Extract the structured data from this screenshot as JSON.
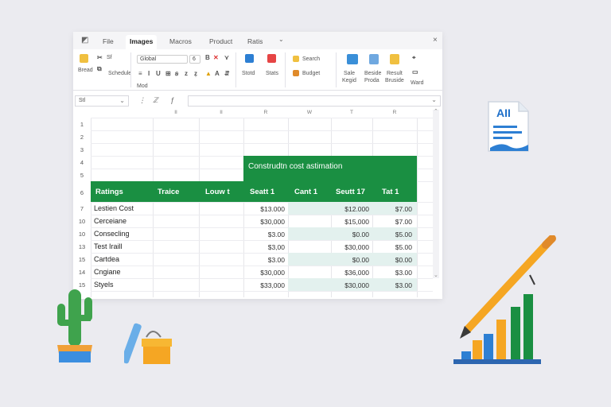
{
  "tabs": [
    "File",
    "Images",
    "Macros",
    "Product",
    "Ratis"
  ],
  "ribbon": {
    "font_name": "Global",
    "font_size": "6",
    "labels": [
      "Bread",
      "Sf",
      "Schedule",
      "Mod",
      "Stotd",
      "Stats",
      "Search",
      "Budget",
      "Sale",
      "Kegid",
      "Beside",
      "Proda",
      "Result",
      "Bruside",
      "Ward"
    ]
  },
  "formula": {
    "namebox": "Stl"
  },
  "sheet": {
    "columns": [
      "II",
      "II",
      "R",
      "W",
      "T",
      "R"
    ],
    "rows": [
      "1",
      "2",
      "3",
      "4",
      "5",
      "6",
      "7",
      "10",
      "10",
      "13",
      "15",
      "14",
      "15"
    ],
    "title": "Construdtn cost astimation",
    "headers": [
      "Ratings",
      "Traice",
      "Louw t",
      "Seatt 1",
      "Cant 1",
      "Seutt 17",
      "Tat 1"
    ],
    "data": [
      {
        "label": "Lestien Cost",
        "c1": "$13.000",
        "c2": "$12.000",
        "c3": "$7.00"
      },
      {
        "label": "Cerceiane",
        "c1": "$30,000",
        "c2": "$15,000",
        "c3": "$7.00"
      },
      {
        "label": "Consecling",
        "c1": "$3.00",
        "c2": "$0.00",
        "c3": "$5.00"
      },
      {
        "label": "Test Iraill",
        "c1": "$3,00",
        "c2": "$30,000",
        "c3": "$5.00"
      },
      {
        "label": "Cartdea",
        "c1": "$3.00",
        "c2": "$0.00",
        "c3": "$0.00"
      },
      {
        "label": "Cngiane",
        "c1": "$30,000",
        "c2": "$36,000",
        "c3": "$3.00"
      },
      {
        "label": "Styels",
        "c1": "$33,000",
        "c2": "$30,000",
        "c3": "$3.00"
      }
    ]
  },
  "doc_badge": "AII",
  "colors": {
    "green": "#1a8f42",
    "accent": "#f5a623",
    "blue": "#2d7fd3"
  }
}
